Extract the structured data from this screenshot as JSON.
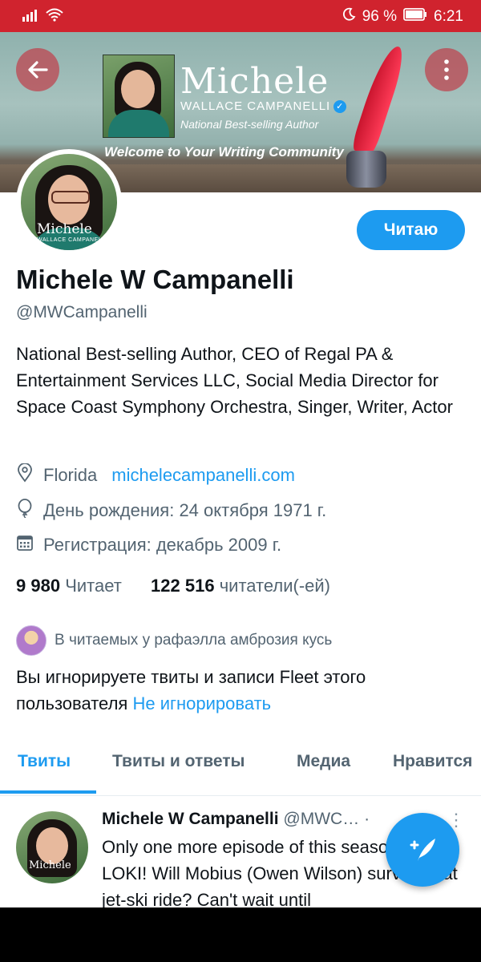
{
  "status_bar": {
    "battery": "96 %",
    "time": "6:21"
  },
  "banner": {
    "brand_name": "Michele",
    "brand_sub": "WALLACE CAMPANELLI",
    "brand_tagline": "National Best-selling Author",
    "welcome": "Welcome to Your Writing Community"
  },
  "avatar": {
    "logo_name": "Michele",
    "logo_sub": "WALLACE CAMPANELLI"
  },
  "profile": {
    "follow_button": "Читаю",
    "name": "Michele W Campanelli",
    "handle": "@MWCampanelli",
    "bio": "National Best-selling Author, CEO of Regal PA & Entertainment Services LLC, Social Media Director for Space Coast Symphony Orchestra, Singer, Writer, Actor",
    "location": "Florida",
    "website": "michelecampanelli.com",
    "birthday": "День рождения: 24 октября 1971 г.",
    "joined": "Регистрация: декабрь 2009 г.",
    "following_count": "9 980",
    "following_label": "Читает",
    "followers_count": "122 516",
    "followers_label": "читатели(-ей)",
    "followed_by": "В читаемых у рафаэлла амброзия кусь",
    "muted_text": "Вы игнорируете твиты и записи Fleet этого пользователя",
    "unmute_link": "Не игнорировать"
  },
  "tabs": [
    {
      "label": "Твиты"
    },
    {
      "label": "Твиты и ответы"
    },
    {
      "label": "Медиа"
    },
    {
      "label": "Нравится"
    }
  ],
  "tweet": {
    "author": "Michele W Campanelli",
    "handle": "@MWC…",
    "separator": "·",
    "text": "Only one more episode of this season of LOKI! Will Mobius (Owen Wilson) survive that jet-ski ride? Can't wait until",
    "avatar_logo": "Michele"
  },
  "colors": {
    "accent": "#1d9bf0",
    "status_bar": "#d0232e",
    "text_secondary": "#536471"
  },
  "icons": [
    "signal-icon",
    "wifi-icon",
    "moon-icon",
    "battery-icon",
    "back-arrow-icon",
    "more-vertical-icon",
    "verified-badge-icon",
    "location-icon",
    "birthday-balloon-icon",
    "calendar-icon",
    "compose-tweet-icon"
  ]
}
